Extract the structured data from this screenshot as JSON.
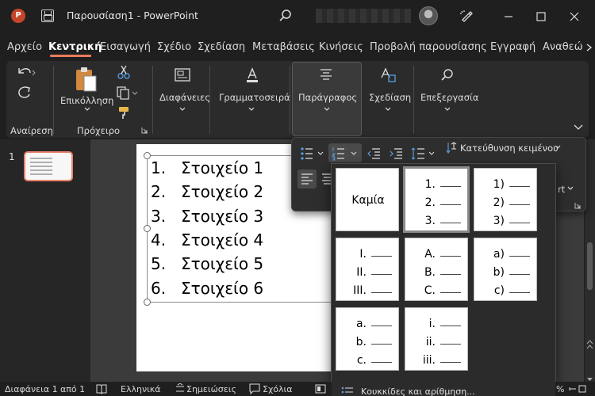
{
  "titlebar": {
    "app_icon_letter": "P",
    "title": "Παρουσίαση1  -  PowerPoint"
  },
  "menu": {
    "items": [
      "Αρχείο",
      "Κεντρική",
      "Εισαγωγή",
      "Σχέδιο",
      "Σχεδίαση",
      "Μεταβάσεις",
      "Κινήσεις",
      "Προβολή παρουσίασης",
      "Εγγραφή",
      "Αναθεώ"
    ],
    "active": "Κεντρική"
  },
  "ribbon": {
    "undo_group": "Αναίρεση",
    "clipboard_group": "Πρόχειρο",
    "paste_label": "Επικόλληση",
    "slides_label": "Διαφάνειες",
    "font_label": "Γραμματοσειρά",
    "paragraph_label": "Παράγραφος",
    "drawing_label": "Σχεδίαση",
    "editing_label": "Επεξεργασία"
  },
  "paragraph_panel": {
    "text_direction": "Κατεύθυνση κειμένου",
    "partial_label": "rt"
  },
  "slides": {
    "current_number": "1"
  },
  "slide": {
    "items": [
      {
        "num": "1.",
        "text": "Στοιχείο 1"
      },
      {
        "num": "2.",
        "text": "Στοιχείο 2"
      },
      {
        "num": "3.",
        "text": "Στοιχείο 3"
      },
      {
        "num": "4.",
        "text": "Στοιχείο 4"
      },
      {
        "num": "5.",
        "text": "Στοιχείο 5"
      },
      {
        "num": "6.",
        "text": "Στοιχείο 6"
      }
    ]
  },
  "numbering_gallery": {
    "none_label": "Καμία",
    "styles": [
      {
        "markers": [
          "1.",
          "2.",
          "3."
        ],
        "selected": true
      },
      {
        "markers": [
          "1)",
          "2)",
          "3)"
        ],
        "selected": false
      },
      {
        "markers": [
          "I.",
          "II.",
          "III."
        ],
        "selected": false
      },
      {
        "markers": [
          "A.",
          "B.",
          "C."
        ],
        "selected": false
      },
      {
        "markers": [
          "a)",
          "b)",
          "c)"
        ],
        "selected": false
      },
      {
        "markers": [
          "a.",
          "b.",
          "c."
        ],
        "selected": false
      },
      {
        "markers": [
          "i.",
          "ii.",
          "iii."
        ],
        "selected": false
      }
    ],
    "footer": "Κουκκίδες και αρίθμηση..."
  },
  "status": {
    "slide_info": "Διαφάνεια 1 από 1",
    "language": "Ελληνικά",
    "notes": "Σημειώσεις",
    "comments": "Σχόλια",
    "zoom_partial": "%"
  },
  "colors": {
    "accent": "#e97b5b",
    "app_icon": "#c4462a"
  }
}
